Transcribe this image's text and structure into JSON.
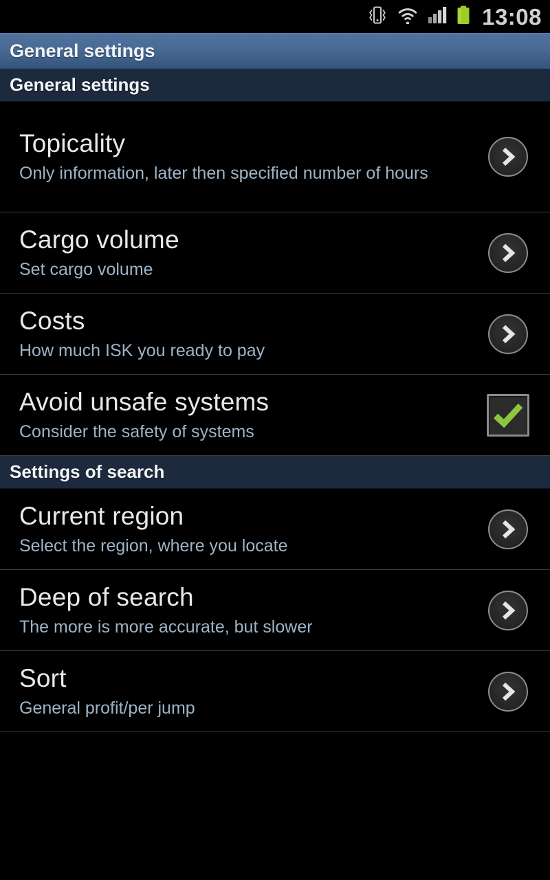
{
  "status_bar": {
    "clock": "13:08",
    "icons": [
      {
        "name": "vibrate-icon",
        "label": "Vibrate mode"
      },
      {
        "name": "wifi-icon",
        "label": "Wi-Fi connected"
      },
      {
        "name": "signal-icon",
        "label": "Cellular signal"
      },
      {
        "name": "battery-icon",
        "label": "Battery full"
      }
    ],
    "battery_color": "#9ccc28"
  },
  "action_bar": {
    "title": "General settings",
    "background_top": "#50729c",
    "background_bottom": "#2b4b70"
  },
  "sections": [
    {
      "header": "General settings",
      "items": [
        {
          "title": "Topicality",
          "subtitle": "Only information, later then specified number of hours",
          "widget": "chevron"
        },
        {
          "title": "Cargo volume",
          "subtitle": "Set cargo volume",
          "widget": "chevron"
        },
        {
          "title": "Costs",
          "subtitle": "How much ISK you ready to pay",
          "widget": "chevron"
        },
        {
          "title": "Avoid unsafe systems",
          "subtitle": "Consider the safety of systems",
          "widget": "checkbox",
          "checked": true
        }
      ]
    },
    {
      "header": "Settings of search",
      "items": [
        {
          "title": "Current region",
          "subtitle": "Select the region, where you locate",
          "widget": "chevron"
        },
        {
          "title": "Deep of search",
          "subtitle": "The more is more accurate, but slower",
          "widget": "chevron"
        },
        {
          "title": "Sort",
          "subtitle": "General profit/per jump",
          "widget": "chevron"
        }
      ]
    }
  ],
  "colors": {
    "accent_blue": "#50729c",
    "section_header_bg": "#1d2a3d",
    "subtitle_text": "#9db4c8",
    "title_text": "#e8e8e8",
    "checkbox_check": "#8cc63f",
    "divider": "#3a3a3a",
    "background": "#000000"
  }
}
